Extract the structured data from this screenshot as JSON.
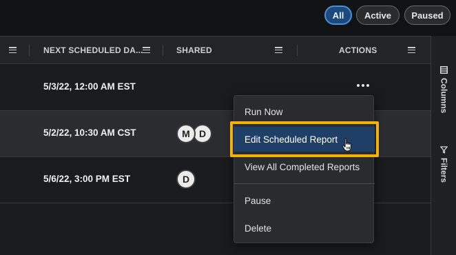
{
  "filters": {
    "all": "All",
    "active": "Active",
    "paused": "Paused",
    "selected": "All"
  },
  "columns": {
    "next_scheduled": "NEXT SCHEDULED DA...",
    "shared": "SHARED",
    "actions": "ACTIONS"
  },
  "rows": [
    {
      "next_scheduled": "5/3/22, 12:00 AM EST",
      "shared": []
    },
    {
      "next_scheduled": "5/2/22, 10:30 AM CST",
      "shared": [
        "M",
        "D"
      ]
    },
    {
      "next_scheduled": "5/6/22, 3:00 PM EST",
      "shared": [
        "D"
      ]
    }
  ],
  "side_panel": {
    "columns": "Columns",
    "filters": "Filters"
  },
  "actions_menu": {
    "run_now": "Run Now",
    "edit": "Edit Scheduled Report",
    "view_all": "View All Completed Reports",
    "pause": "Pause",
    "delete": "Delete",
    "highlighted": "Edit Scheduled Report"
  },
  "colors": {
    "highlight": "#1f3f66",
    "focus_outline": "#f2b20d",
    "selected_pill": "#1d4a7c"
  }
}
